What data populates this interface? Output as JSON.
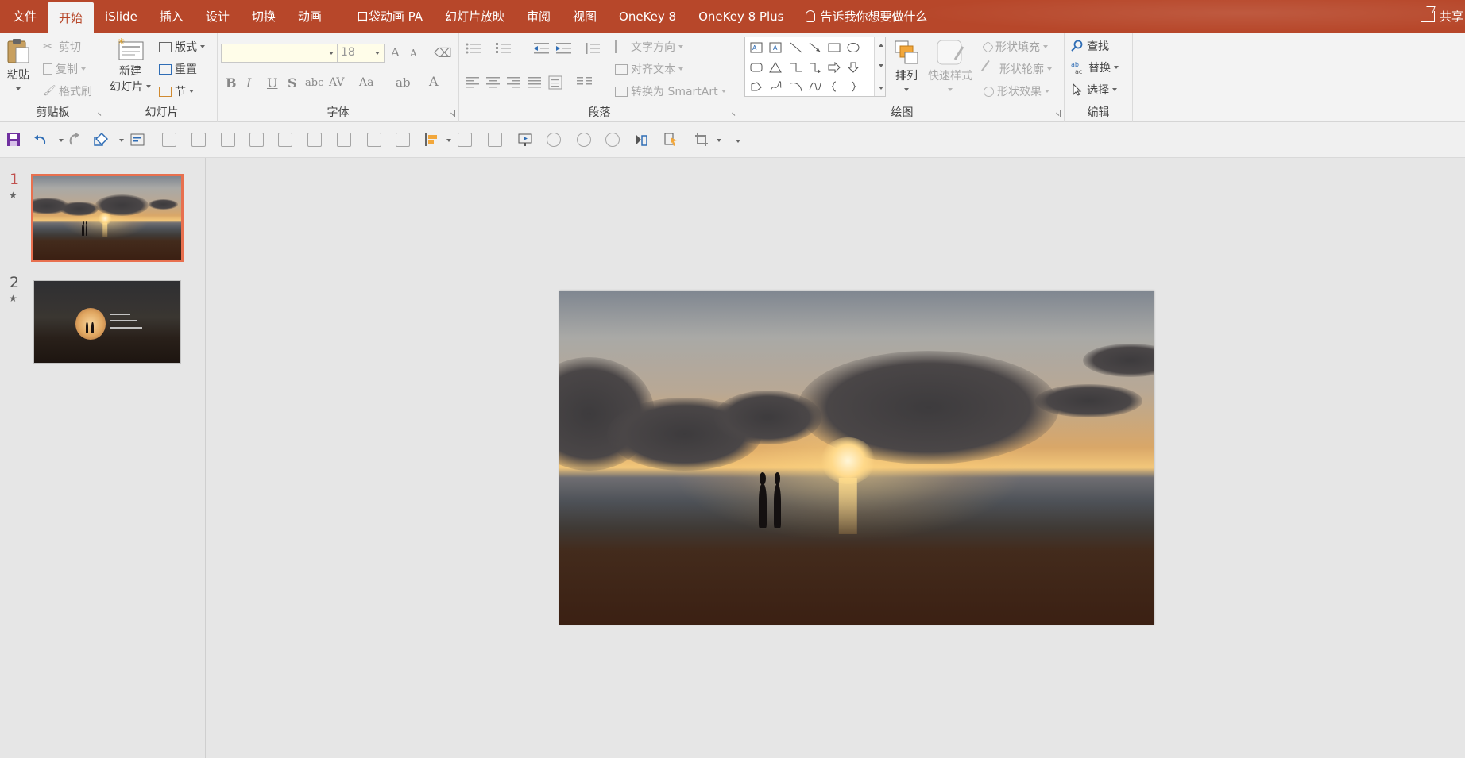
{
  "tabs": [
    {
      "label": "文件",
      "active": false
    },
    {
      "label": "开始",
      "active": true
    },
    {
      "label": "iSlide",
      "active": false
    },
    {
      "label": "插入",
      "active": false
    },
    {
      "label": "设计",
      "active": false
    },
    {
      "label": "切换",
      "active": false
    },
    {
      "label": "动画",
      "active": false
    },
    {
      "label": "口袋动画 PA",
      "active": false
    },
    {
      "label": "幻灯片放映",
      "active": false
    },
    {
      "label": "审阅",
      "active": false
    },
    {
      "label": "视图",
      "active": false
    },
    {
      "label": "OneKey 8",
      "active": false
    },
    {
      "label": "OneKey 8 Plus",
      "active": false
    }
  ],
  "tell_me": "告诉我你想要做什么",
  "share": "共享",
  "ribbon": {
    "clipboard": {
      "label": "剪贴板",
      "paste": "粘贴",
      "cut": "剪切",
      "copy": "复制",
      "format_painter": "格式刷"
    },
    "slides": {
      "label": "幻灯片",
      "new_slide_1": "新建",
      "new_slide_2": "幻灯片",
      "layout": "版式",
      "reset": "重置",
      "section": "节"
    },
    "font": {
      "label": "字体",
      "font_name": "",
      "font_size": "18",
      "bold": "B",
      "italic": "I",
      "underline": "U",
      "shadow": "S",
      "strike": "abc",
      "spacing": "AV",
      "case": "Aa",
      "grow": "A",
      "shrink": "A",
      "color": "A"
    },
    "paragraph": {
      "label": "段落",
      "text_direction": "文字方向",
      "align_text": "对齐文本",
      "smartart": "转换为 SmartArt"
    },
    "drawing": {
      "label": "绘图",
      "arrange": "排列",
      "quick_styles": "快速样式",
      "shape_fill": "形状填充",
      "shape_outline": "形状轮廓",
      "shape_effects": "形状效果"
    },
    "editing": {
      "label": "编辑",
      "find": "查找",
      "replace": "替换",
      "select": "选择"
    }
  },
  "slides": [
    {
      "number": "1",
      "marker": "★",
      "selected": true
    },
    {
      "number": "2",
      "marker": "★",
      "selected": false
    }
  ],
  "colors": {
    "accent": "#b7472a",
    "selection": "#e8704f"
  }
}
